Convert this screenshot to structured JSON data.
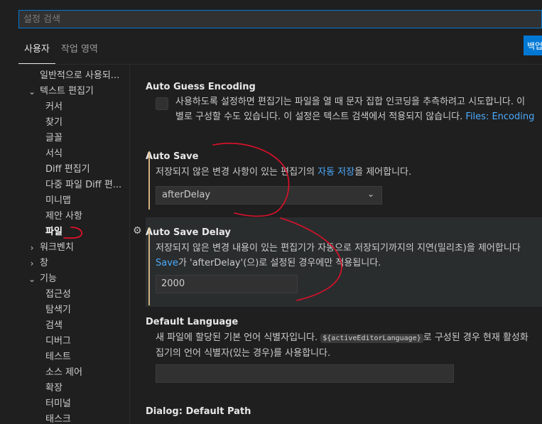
{
  "search": {
    "placeholder": "설정 검색"
  },
  "tabs": [
    {
      "label": "사용자"
    },
    {
      "label": "작업 영역"
    }
  ],
  "backup_button": {
    "label": "백업"
  },
  "tree": {
    "items": [
      {
        "label": "일반적으로 사용되..."
      },
      {
        "label": "텍스트 편집기"
      },
      {
        "label": "커서"
      },
      {
        "label": "찾기"
      },
      {
        "label": "글꼴"
      },
      {
        "label": "서식"
      },
      {
        "label": "Diff 편집기"
      },
      {
        "label": "다중 파일 Diff 편..."
      },
      {
        "label": "미니맵"
      },
      {
        "label": "제안 사항"
      },
      {
        "label": "파일"
      },
      {
        "label": "워크벤치"
      },
      {
        "label": "창"
      },
      {
        "label": "기능"
      },
      {
        "label": "접근성"
      },
      {
        "label": "탐색기"
      },
      {
        "label": "검색"
      },
      {
        "label": "디버그"
      },
      {
        "label": "테스트"
      },
      {
        "label": "소스 제어"
      },
      {
        "label": "확장"
      },
      {
        "label": "터미널"
      },
      {
        "label": "태스크"
      }
    ]
  },
  "settings": {
    "auto_guess_encoding": {
      "title": "Auto Guess Encoding",
      "desc_line1": "사용하도록 설정하면 편집기는 파일을 열 때 문자 집합 인코딩을 추측하려고 시도합니다. 이",
      "desc_line2": "별로 구성할 수도 있습니다. 이 설정은 텍스트 검색에서 적용되지 않습니다.",
      "link": "Files: Encoding"
    },
    "auto_save": {
      "title": "Auto Save",
      "desc_before": "저장되지 않은 변경 사항이 있는 편집기의",
      "desc_link": "자동 저장",
      "desc_after": "을 제어합니다.",
      "value": "afterDelay"
    },
    "auto_save_delay": {
      "title": "Auto Save Delay",
      "desc_line1": "저장되지 않은 변경 내용이 있는 편집기가 자동으로 저장되기까지의 지연(밀리초)을 제어합니다",
      "desc_link": "Save",
      "desc_line2": "가 'afterDelay'(으)로 설정된 경우에만 적용됩니다.",
      "value": "2000"
    },
    "default_language": {
      "title": "Default Language",
      "desc_line1_before": "새 파일에 할당된 기본 언어 식별자입니다.",
      "desc_code": "${activeEditorLanguage}",
      "desc_line1_after": "로 구성된 경우 현재 활성화",
      "desc_line2": "집기의 언어 식별자(있는 경우)를 사용합니다.",
      "value": ""
    },
    "dialog_default_path": {
      "category": "Dialog:",
      "title": "Default Path"
    }
  },
  "colors": {
    "accent": "#0078d4",
    "link": "#4daafc",
    "annotation_red": "#e0102a",
    "modified": "#e2c08d"
  }
}
